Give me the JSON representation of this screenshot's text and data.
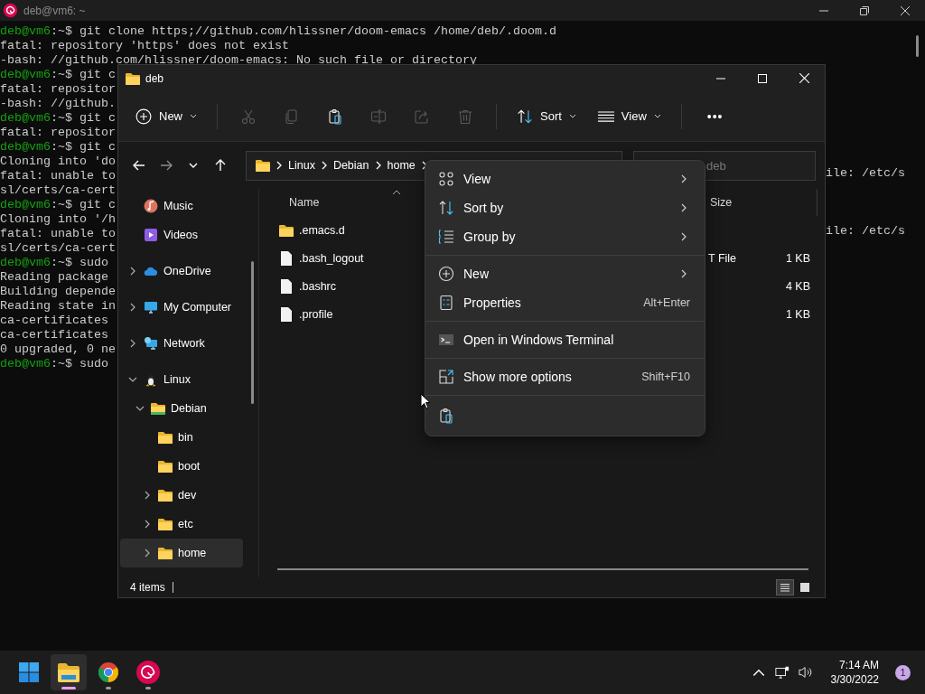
{
  "terminal": {
    "title": "deb@vm6: ~",
    "lines": [
      {
        "user": "deb@vm6",
        "cwd": ":~$",
        "text": " git clone https;//github.com/hlissner/doom-emacs /home/deb/.doom.d"
      },
      {
        "text": "fatal: repository 'https' does not exist"
      },
      {
        "text": "-bash: //github.com/hlissner/doom-emacs: No such file or directory"
      },
      {
        "user": "deb@vm6",
        "cwd": ":~$",
        "text": " git c"
      },
      {
        "text": "fatal: repositor"
      },
      {
        "text": "-bash: //github."
      },
      {
        "user": "deb@vm6",
        "cwd": ":~$",
        "text": " git c"
      },
      {
        "text": "fatal: repositor"
      },
      {
        "user": "deb@vm6",
        "cwd": ":~$",
        "text": " git c"
      },
      {
        "text": "Cloning into 'do"
      },
      {
        "text": "fatal: unable to",
        "tail": "ile: /etc/s"
      },
      {
        "text": "sl/certs/ca-cert"
      },
      {
        "user": "deb@vm6",
        "cwd": ":~$",
        "text": " git c"
      },
      {
        "text": "Cloning into '/h"
      },
      {
        "text": "fatal: unable to",
        "tail": "ile: /etc/s"
      },
      {
        "text": "sl/certs/ca-cert"
      },
      {
        "user": "deb@vm6",
        "cwd": ":~$",
        "text": " sudo"
      },
      {
        "text": "Reading package"
      },
      {
        "text": "Building depende"
      },
      {
        "text": "Reading state in"
      },
      {
        "text": "ca-certificates"
      },
      {
        "text": "ca-certificates"
      },
      {
        "text": "0 upgraded, 0 ne"
      },
      {
        "user": "deb@vm6",
        "cwd": ":~$",
        "text": " sudo"
      }
    ]
  },
  "explorer": {
    "title": "deb",
    "toolbar": {
      "new": "New",
      "actions": [
        {
          "kind": "cut",
          "disabled": true
        },
        {
          "kind": "copy",
          "disabled": true
        },
        {
          "kind": "paste",
          "disabled": false
        },
        {
          "kind": "rename",
          "disabled": true
        },
        {
          "kind": "share",
          "disabled": true
        },
        {
          "kind": "delete",
          "disabled": true
        }
      ],
      "sort": "Sort",
      "view": "View",
      "more": "•••"
    },
    "nav_buttons": [
      {
        "kind": "back",
        "disabled": false
      },
      {
        "kind": "forward",
        "disabled": true
      },
      {
        "kind": "recent",
        "disabled": false
      },
      {
        "kind": "up",
        "disabled": false
      }
    ],
    "address": {
      "crumbs": [
        "Linux",
        "Debian",
        "home"
      ]
    },
    "search": {
      "placeholder": "deb"
    },
    "nav": [
      {
        "label": "Music",
        "kind": "music",
        "selected": false
      },
      {
        "label": "Videos",
        "kind": "videos",
        "selected": false
      },
      {
        "label": "OneDrive",
        "kind": "cloud",
        "expanded": false,
        "selected": false
      },
      {
        "label": "My Computer",
        "kind": "computer",
        "expanded": false,
        "selected": false
      },
      {
        "label": "Network",
        "kind": "network",
        "expanded": false,
        "selected": false
      },
      {
        "label": "Linux",
        "kind": "linux",
        "expanded": true,
        "selected": false,
        "children": [
          {
            "label": "Debian",
            "kind": "distro",
            "expanded": true,
            "selected": false,
            "children": [
              {
                "label": "bin",
                "kind": "folder",
                "selected": false
              },
              {
                "label": "boot",
                "kind": "folder",
                "selected": false
              },
              {
                "label": "dev",
                "kind": "folder",
                "expanded": false,
                "selected": false
              },
              {
                "label": "etc",
                "kind": "folder",
                "expanded": false,
                "selected": false
              },
              {
                "label": "home",
                "kind": "folder",
                "expanded": false,
                "selected": true
              }
            ]
          }
        ]
      }
    ],
    "columns": {
      "name": "Name",
      "size": "Size"
    },
    "files": [
      {
        "name": ".emacs.d",
        "kind": "folder"
      },
      {
        "name": ".bash_logout",
        "kind": "file",
        "type": "T File",
        "size": "1 KB"
      },
      {
        "name": ".bashrc",
        "kind": "file",
        "size": "4 KB"
      },
      {
        "name": ".profile",
        "kind": "file",
        "size": "1 KB"
      }
    ],
    "status": "4 items",
    "views": [
      {
        "kind": "details",
        "selected": true
      },
      {
        "kind": "tiles",
        "selected": false
      }
    ]
  },
  "menu": [
    {
      "kind": "view",
      "label": "View",
      "submenu": true
    },
    {
      "kind": "sort",
      "label": "Sort by",
      "submenu": true
    },
    {
      "kind": "group",
      "label": "Group by",
      "submenu": true
    },
    {
      "kind": "separator"
    },
    {
      "kind": "new",
      "label": "New",
      "submenu": true
    },
    {
      "kind": "properties",
      "label": "Properties",
      "shortcut": "Alt+Enter",
      "submenu": false
    },
    {
      "kind": "separator"
    },
    {
      "kind": "terminal",
      "label": "Open in Windows Terminal",
      "submenu": false
    },
    {
      "kind": "separator"
    },
    {
      "kind": "more",
      "label": "Show more options",
      "shortcut": "Shift+F10",
      "submenu": false
    },
    {
      "kind": "separator"
    },
    {
      "kind": "paste",
      "submenu": false
    }
  ],
  "taskbar": {
    "apps": [
      {
        "kind": "start",
        "active": false,
        "running": false
      },
      {
        "kind": "explorer",
        "active": true,
        "running": true
      },
      {
        "kind": "chrome",
        "active": false,
        "running": true
      },
      {
        "kind": "debian",
        "active": false,
        "running": true
      }
    ],
    "time": "7:14 AM",
    "date": "3/30/2022",
    "badge": "1"
  }
}
